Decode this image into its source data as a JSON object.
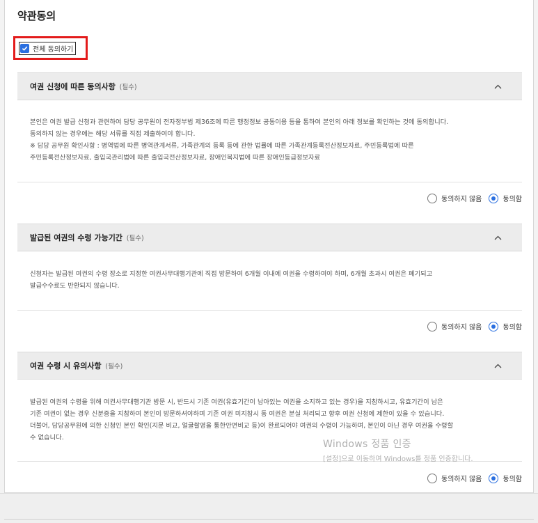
{
  "page": {
    "title": "약관동의"
  },
  "agree_all": {
    "label": "전체 동의하기",
    "checked": true,
    "highlight_color": "#e31b1b"
  },
  "sections": [
    {
      "title": "여권 신청에 따른 동의사항",
      "required": "(필수)",
      "body": [
        "본인은 여권 발급 신청과 관련하여 담당 공무원이 전자정부법 제36조에 따른 행정정보 공동이용 등을 통하여 본인의 아래 정보를 확인하는 것에 동의합니다.",
        "동의하지 않는 경우에는 해당 서류를 직접 제출하여야 합니다.",
        "※ 담당 공무원 확인사항 : 병역법에 따른 병역관계서류, 가족관계의 등록 등에 관한 법률에 따른 가족관계등록전산정보자료, 주민등록법에 따른",
        "주민등록전산정보자료, 출입국관리법에 따른 출입국전산정보자료, 장애인복지법에 따른 장애인등급정보자료"
      ],
      "disagree_label": "동의하지 않음",
      "agree_label": "동의함",
      "selected": "agree"
    },
    {
      "title": "발급된 여권의 수령 가능기간",
      "required": "(필수)",
      "body": [
        "신청자는 발급된 여권의 수령 장소로 지정한 여권사무대행기관에 직접 방문하여 6개월 이내에 여권을 수령하여야 하며, 6개월 초과시 여권은 폐기되고",
        "발급수수료도 반환되지 않습니다."
      ],
      "disagree_label": "동의하지 않음",
      "agree_label": "동의함",
      "selected": "agree"
    },
    {
      "title": "여권 수령 시 유의사항",
      "required": "(필수)",
      "body": [
        "발급된 여권의 수령을 위해 여권사무대행기관 방문 시, 반드시 기존 여권(유효기간이 남아있는 여권을 소지하고 있는 경우)을 지참하시고, 유효기간이 남은",
        "기존 여권이 없는 경우 신분증을 지참하여 본인이 방문하셔야하며 기존 여권 미지참시 동 여권은 분실 처리되고 향후 여권 신청에 제한이 있을 수 있습니다.",
        "더불어, 담당공무원에 의한 신청인 본인 확인(지문 비교, 얼굴촬영을 통한안면비교 등)이 완료되어야 여권의 수령이 가능하며, 본인이 아닌 경우 여권을 수령할",
        "수 없습니다."
      ],
      "disagree_label": "동의하지 않음",
      "agree_label": "동의함",
      "selected": "agree"
    }
  ],
  "watermark": {
    "title": "Windows 정품 인증",
    "subtitle": "[설정]으로 이동하여 Windows를 정품 인증합니다."
  },
  "colors": {
    "accent": "#2a6fe0",
    "header_bg": "#ececec"
  }
}
